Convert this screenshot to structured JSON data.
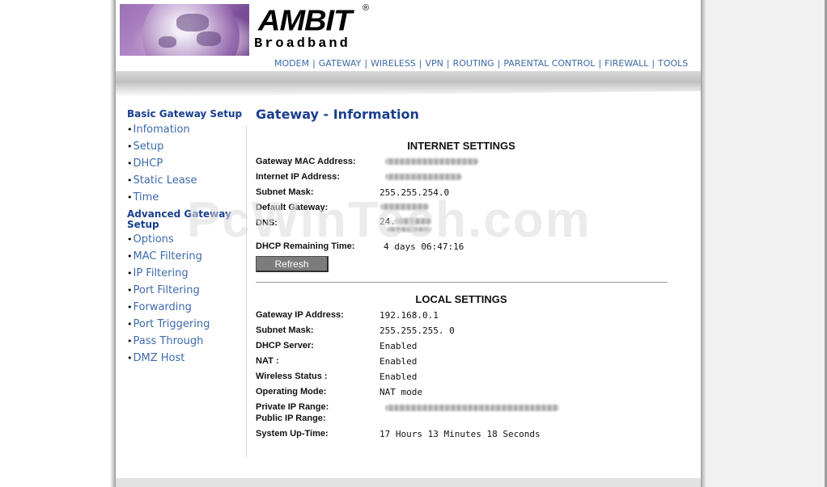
{
  "brand": {
    "name": "AMBIT",
    "registered": "®",
    "subtitle": "Broadband"
  },
  "topnav": [
    "MODEM",
    "GATEWAY",
    "WIRELESS",
    "VPN",
    "ROUTING",
    "PARENTAL CONTROL",
    "FIREWALL",
    "TOOLS"
  ],
  "sidebar": {
    "basic_heading": "Basic Gateway Setup",
    "basic_items": [
      "Infomation",
      "Setup",
      "DHCP",
      "Static Lease",
      "Time"
    ],
    "advanced_heading_line1": "Advanced Gateway",
    "advanced_heading_line2": "Setup",
    "advanced_items": [
      "Options",
      "MAC Filtering",
      "IP Filtering",
      "Port Filtering",
      "Forwarding",
      "Port Triggering",
      "Pass Through",
      "DMZ Host"
    ]
  },
  "page": {
    "title": "Gateway - Information",
    "watermark": "PcWinTech.com"
  },
  "internet": {
    "heading": "INTERNET SETTINGS",
    "mac_label": "Gateway MAC Address:",
    "ip_label": "Internet IP Address:",
    "mask_label": "Subnet Mask:",
    "mask_value": "255.255.254.0",
    "gateway_label": "Default Gateway:",
    "dns_label": "DNS:",
    "dns_value_partial": "24.",
    "dhcp_label": "DHCP Remaining Time:",
    "dhcp_value": "4 days 06:47:16",
    "refresh_label": "Refresh"
  },
  "local": {
    "heading": "LOCAL SETTINGS",
    "gw_ip_label": "Gateway IP Address:",
    "gw_ip_value": "192.168.0.1",
    "mask_label": "Subnet Mask:",
    "mask_value": "255.255.255. 0",
    "dhcp_label": "DHCP Server:",
    "dhcp_value": "Enabled",
    "nat_label": "NAT :",
    "nat_value": "Enabled",
    "wireless_label": "Wireless Status :",
    "wireless_value": "Enabled",
    "mode_label": "Operating Mode:",
    "mode_value": "NAT mode",
    "private_label": "Private IP Range:",
    "public_label": "Public IP Range:",
    "uptime_label": "System Up-Time:",
    "uptime_value": "17 Hours 13 Minutes 18 Seconds"
  },
  "colors": {
    "nav_link": "#3d6aaa",
    "heading": "#1a3f8f",
    "button_bg": "#7c7c7c"
  }
}
